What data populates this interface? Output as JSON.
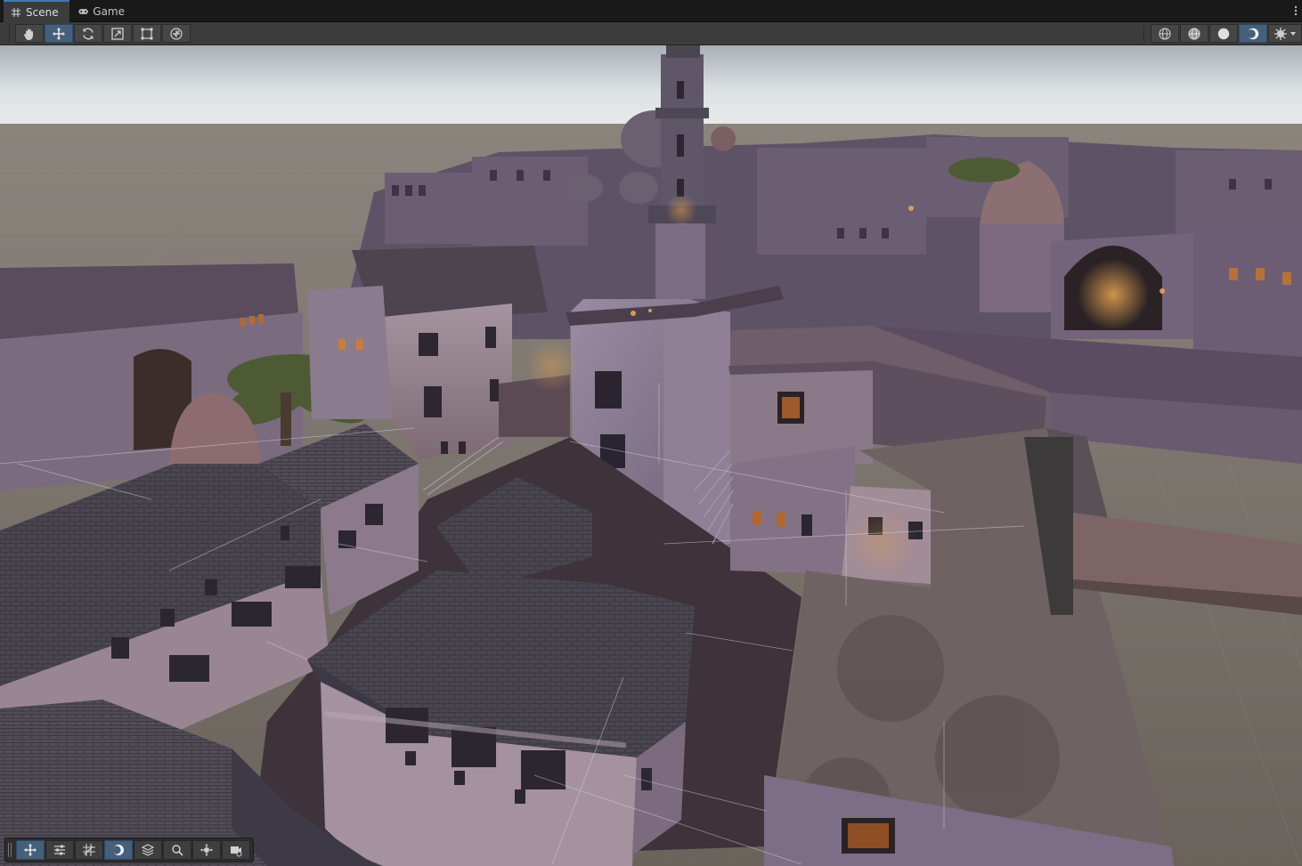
{
  "tabs": [
    {
      "label": "Scene",
      "icon": "grid-icon",
      "active": true
    },
    {
      "label": "Game",
      "icon": "gamepad-icon",
      "active": false
    }
  ],
  "toolbar": {
    "tools": [
      {
        "name": "hand-tool",
        "icon": "hand-icon"
      },
      {
        "name": "move-tool",
        "icon": "move-arrows-icon",
        "active": true
      },
      {
        "name": "rotate-tool",
        "icon": "rotate-icon"
      },
      {
        "name": "scale-tool",
        "icon": "scale-icon"
      },
      {
        "name": "rect-tool",
        "icon": "rect-transform-icon"
      },
      {
        "name": "transform-tool",
        "icon": "transform-icon"
      }
    ],
    "shading_modes": [
      {
        "name": "wireframe",
        "icon": "wireframe-sphere-icon"
      },
      {
        "name": "shaded-wireframe",
        "icon": "shaded-wireframe-icon"
      },
      {
        "name": "unlit",
        "icon": "unlit-sphere-icon"
      },
      {
        "name": "lit",
        "icon": "lit-sphere-icon",
        "active": true
      }
    ],
    "extra": {
      "name": "effects",
      "icon": "effects-icon"
    }
  },
  "overlay_toolbar": [
    {
      "name": "move",
      "icon": "move-arrows-icon",
      "active": true
    },
    {
      "name": "tool-settings",
      "icon": "sliders-icon"
    },
    {
      "name": "grid-snapping",
      "icon": "grid-snap-icon"
    },
    {
      "name": "view-options",
      "icon": "moon-icon",
      "active": true
    },
    {
      "name": "layers",
      "icon": "layers-icon"
    },
    {
      "name": "search",
      "icon": "search-icon"
    },
    {
      "name": "pivot",
      "icon": "pivot-icon"
    },
    {
      "name": "camera",
      "icon": "camera-icon"
    }
  ],
  "colors": {
    "accent": "#3a79bb",
    "active_button": "#46607c",
    "sky_top": "#c8ced3",
    "ground": "#6e6760",
    "roof": "#4a4650",
    "wall": "#8f7f93",
    "window_light": "#d58a3a"
  }
}
